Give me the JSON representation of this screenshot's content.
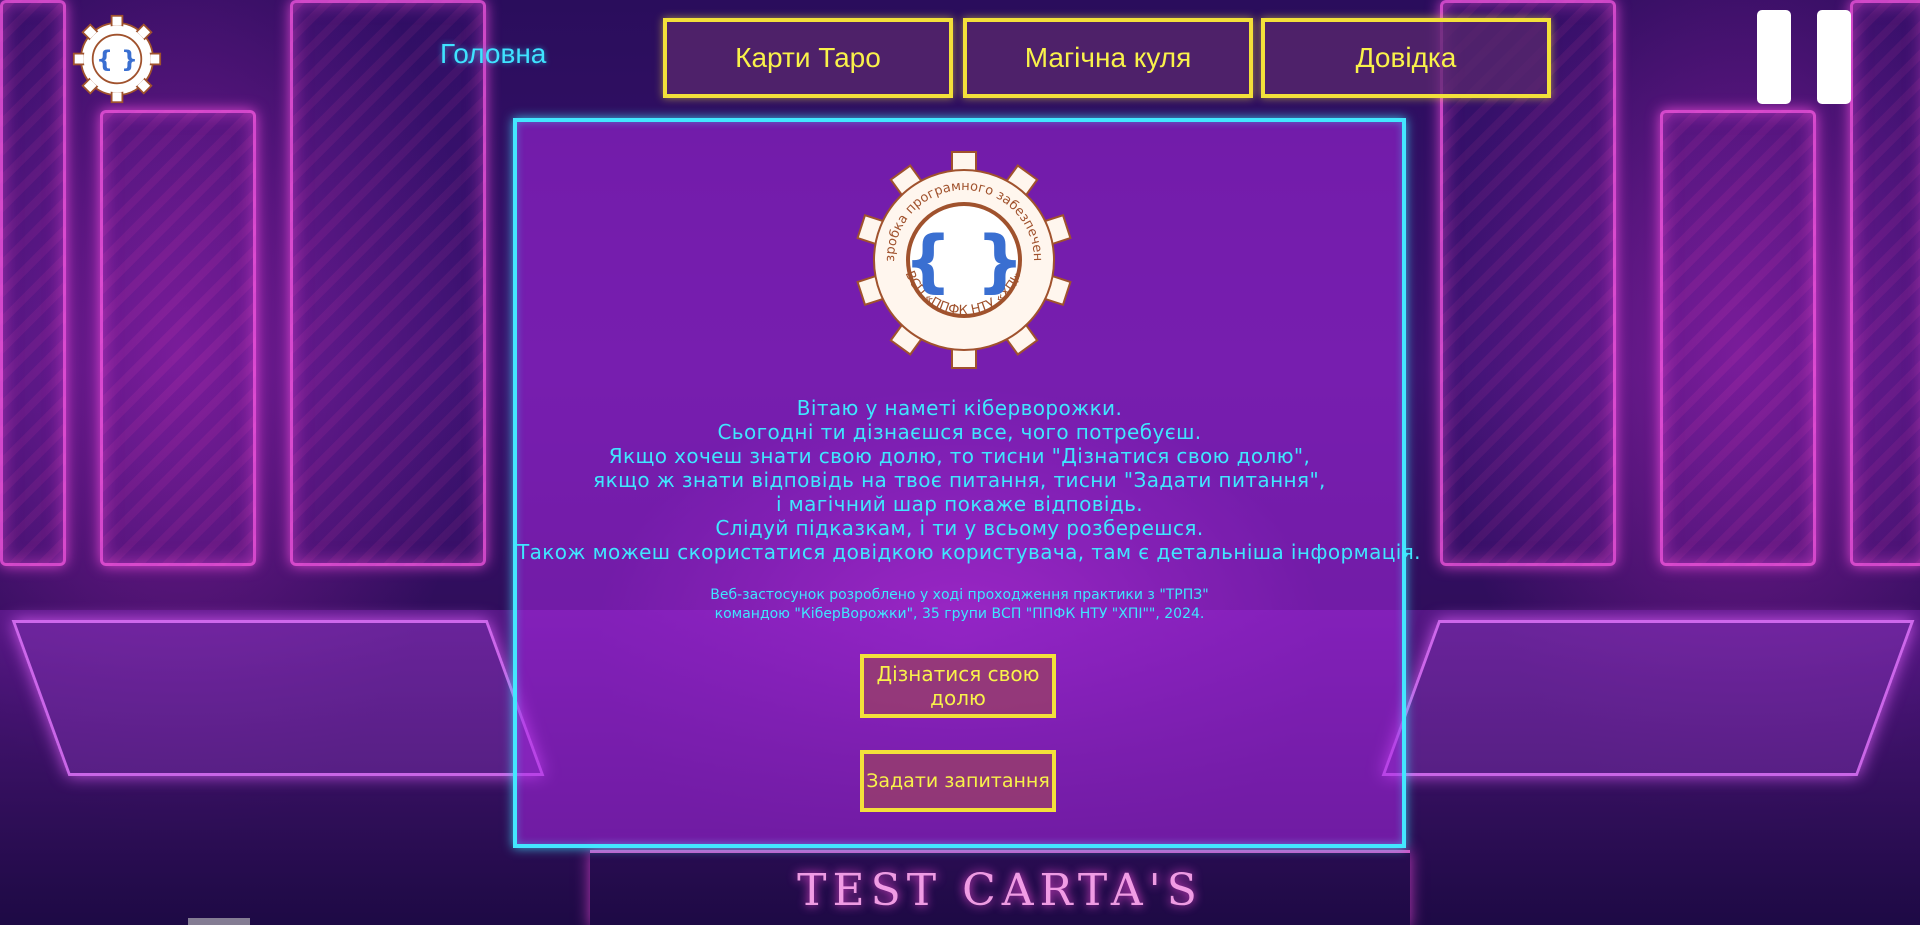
{
  "background": {
    "sign_text": "TEST CARTA'S"
  },
  "header": {
    "logo_inner_text": "{ }",
    "nav": {
      "home": "Головна",
      "tarot": "Карти Таро",
      "magic_ball": "Магічна куля",
      "help": "Довідка"
    }
  },
  "card": {
    "logo": {
      "ring_top": "Розробка програмного забезпечення",
      "ring_bottom": "ВСП «ППФК НТУ «ХПІ»",
      "inner_text": "{ }"
    },
    "welcome_lines": [
      "Вітаю у наметі кіберворожки.",
      "Сьогодні ти дізнаєшся все, чого потребуєш.",
      "Якщо хочеш знати свою долю, то тисни \"Дізнатися свою долю\",",
      "якщо ж знати відповідь на твоє питання, тисни \"Задати питання\",",
      "і магічний шар покаже відповідь.",
      "Слідуй підказкам, і ти у всьому розберешся.",
      "Також можеш скористатися довідкою користувача, там є детальніша інформація."
    ],
    "credits_lines": [
      "Веб-застосунок розроблено у ході проходження практики з \"ТРПЗ\"",
      "командою \"КіберВорожки\", 35 групи ВСП \"ППФК НТУ \"ХПІ\"\", 2024."
    ],
    "buttons": {
      "fate": "Дізнатися свою долю",
      "ask": "Задати запитання"
    }
  },
  "colors": {
    "accent_cyan": "#43e7ff",
    "accent_yellow": "#f3e03a",
    "logo_brown": "#a0522d",
    "logo_blue": "#3a6fd1"
  }
}
